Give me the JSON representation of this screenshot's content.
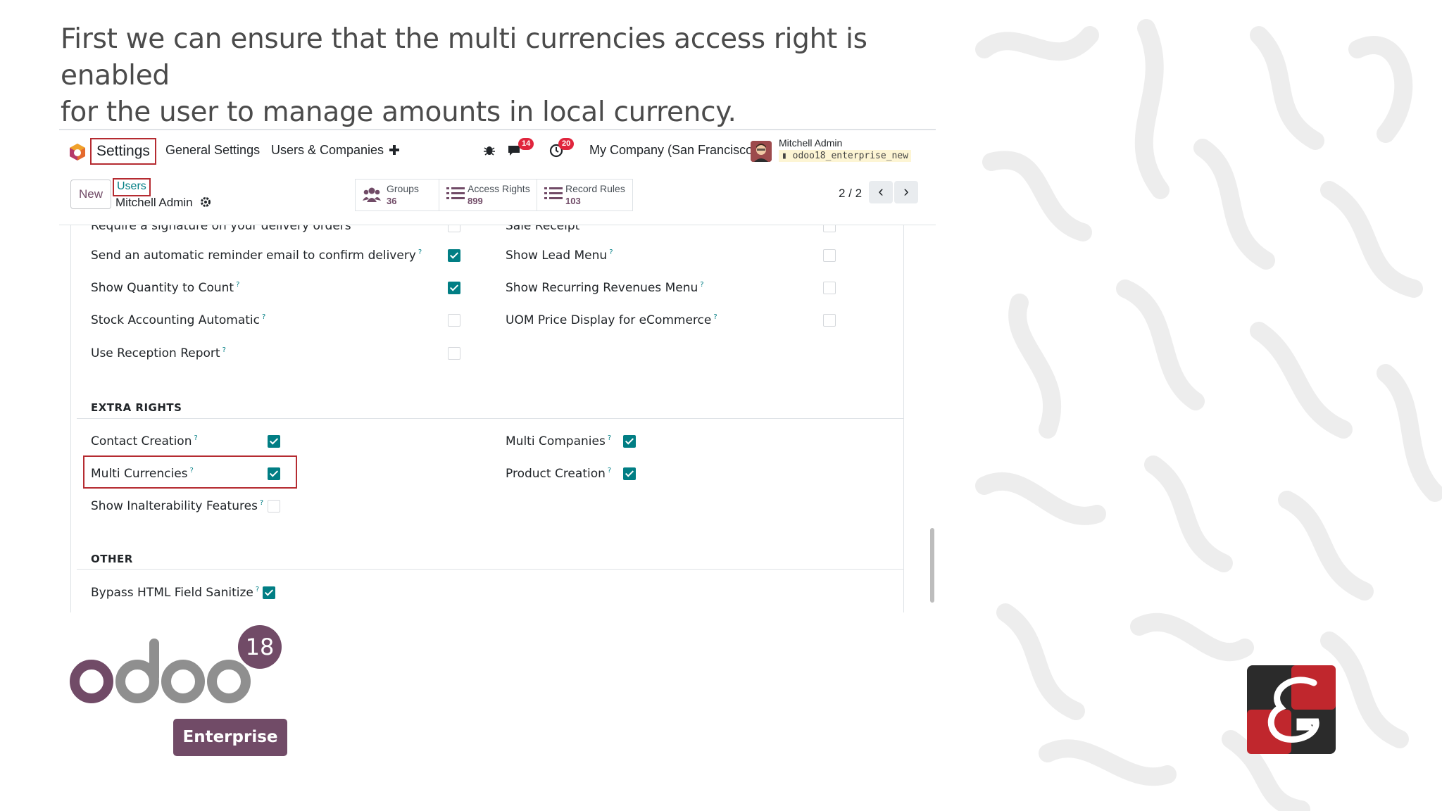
{
  "slide": {
    "headline_line1": "First we can ensure that the multi currencies access right is enabled",
    "headline_line2": "for the user to manage amounts in local currency."
  },
  "navbar": {
    "app_name": "Settings",
    "menu": [
      "General Settings",
      "Users & Companies"
    ],
    "add_icon": "plus-icon",
    "messages_count": "14",
    "activities_count": "20",
    "company": "My Company (San Francisco)",
    "user_name": "Mitchell Admin",
    "database": "odoo18_enterprise_new"
  },
  "control": {
    "new_label": "New",
    "breadcrumb_parent": "Users",
    "breadcrumb_record": "Mitchell Admin",
    "smart_buttons": [
      {
        "title": "Groups",
        "count": "36",
        "icon": "users-icon"
      },
      {
        "title": "Access Rights",
        "count": "899",
        "icon": "list-icon"
      },
      {
        "title": "Record Rules",
        "count": "103",
        "icon": "list-icon"
      }
    ],
    "pager": "2 / 2"
  },
  "rights": {
    "left_top": [
      {
        "label": "Require a signature on your delivery orders",
        "checked": false
      },
      {
        "label": "Send an automatic reminder email to confirm delivery",
        "checked": true
      },
      {
        "label": "Show Quantity to Count",
        "checked": true
      },
      {
        "label": "Stock Accounting Automatic",
        "checked": false
      },
      {
        "label": "Use Reception Report",
        "checked": false
      }
    ],
    "right_top": [
      {
        "label": "Sale Receipt",
        "checked": false
      },
      {
        "label": "Show Lead Menu",
        "checked": false
      },
      {
        "label": "Show Recurring Revenues Menu",
        "checked": false
      },
      {
        "label": "UOM Price Display for eCommerce",
        "checked": false
      }
    ],
    "extra_title": "EXTRA RIGHTS",
    "extra_left": [
      {
        "label": "Contact Creation",
        "checked": true
      },
      {
        "label": "Multi Currencies",
        "checked": true
      },
      {
        "label": "Show Inalterability Features",
        "checked": false
      }
    ],
    "extra_right": [
      {
        "label": "Multi Companies",
        "checked": true
      },
      {
        "label": "Product Creation",
        "checked": true
      }
    ],
    "other_title": "OTHER",
    "other_left": [
      {
        "label": "Bypass HTML Field Sanitize",
        "checked": true
      }
    ],
    "help_mark": "?"
  },
  "branding": {
    "version": "18",
    "edition": "Enterprise",
    "logo_colors": {
      "purple": "#714b67",
      "grey": "#8f8f8f",
      "red": "#c0272d",
      "dark": "#2b2b2b"
    }
  }
}
